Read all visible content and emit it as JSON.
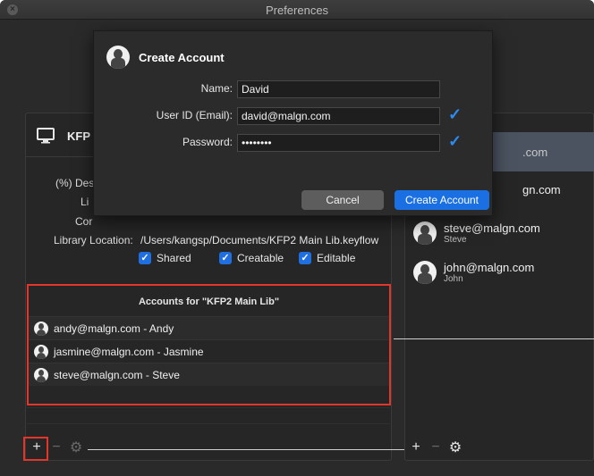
{
  "window": {
    "title": "Preferences"
  },
  "library": {
    "name": "KFP",
    "labels": {
      "description": "(%) Des",
      "li": "Li",
      "cor": "Cor",
      "location": "Library Location:"
    },
    "location": "/Users/kangsp/Documents/KFP2 Main Lib.keyflow",
    "checks": [
      "Shared",
      "Creatable",
      "Editable"
    ]
  },
  "accounts_panel": {
    "title": "Accounts for \"KFP2 Main Lib\"",
    "items": [
      "andy@malgn.com - Andy",
      "jasmine@malgn.com - Jasmine",
      "steve@malgn.com - Steve"
    ]
  },
  "left_toolbar": {
    "add": "+",
    "remove": "−",
    "settings": "⚙"
  },
  "right_panel": {
    "items": [
      {
        "email": ".com",
        "name": ""
      },
      {
        "email": "gn.com",
        "name": ""
      },
      {
        "email": "steve@malgn.com",
        "name": "Steve"
      },
      {
        "email": "john@malgn.com",
        "name": "John"
      }
    ]
  },
  "right_toolbar": {
    "add": "+",
    "remove": "−",
    "settings": "⚙"
  },
  "modal": {
    "title": "Create Account",
    "name_label": "Name:",
    "name_value": "David",
    "userid_label": "User ID (Email):",
    "userid_value": "david@malgn.com",
    "password_label": "Password:",
    "password_value": "••••••••",
    "cancel": "Cancel",
    "create": "Create Account"
  },
  "colors": {
    "accent": "#1a6fe3",
    "highlight": "#e0362c",
    "check": "#2c8cf2"
  }
}
